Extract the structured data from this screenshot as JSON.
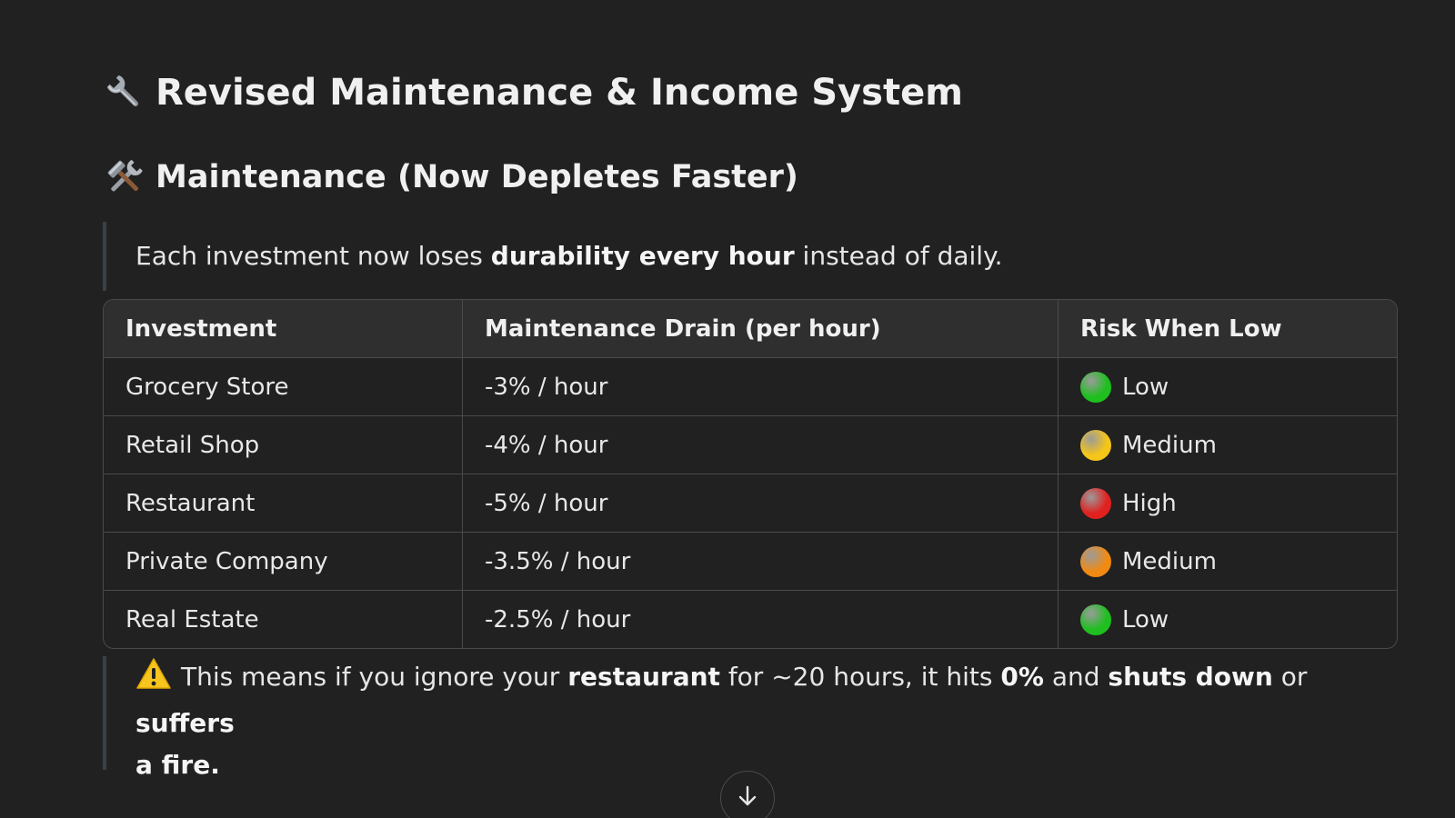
{
  "header": {
    "title": "Revised Maintenance & Income System",
    "title_icon": "wrench-icon",
    "subtitle": "Maintenance (Now Depletes Faster)",
    "subtitle_icon": "hammer-and-wrench-icon"
  },
  "intro": {
    "pre": "Each investment now loses ",
    "bold": "durability every hour",
    "post": " instead of daily."
  },
  "table": {
    "headers": [
      "Investment",
      "Maintenance Drain (per hour)",
      "Risk When Low"
    ],
    "rows": [
      {
        "investment": "Grocery Store",
        "drain": "-3% / hour",
        "risk": "Low",
        "risk_color": "#1fbf1f"
      },
      {
        "investment": "Retail Shop",
        "drain": "-4% / hour",
        "risk": "Medium",
        "risk_color": "#f5c518"
      },
      {
        "investment": "Restaurant",
        "drain": "-5% / hour",
        "risk": "High",
        "risk_color": "#e0211f"
      },
      {
        "investment": "Private Company",
        "drain": "-3.5% / hour",
        "risk": "Medium",
        "risk_color": "#f08a13"
      },
      {
        "investment": "Real Estate",
        "drain": "-2.5% / hour",
        "risk": "Low",
        "risk_color": "#1fbf1f"
      }
    ]
  },
  "warning": {
    "icon": "warning-icon",
    "t1": "This means if you ignore your ",
    "b1": "restaurant",
    "t2": " for ~20 hours, it hits ",
    "b2": "0%",
    "t3": " and ",
    "b3": "shuts down",
    "t4": " or ",
    "b4": "suffers",
    "b5": "a fire."
  },
  "scroll_button": {
    "icon": "arrow-down-icon"
  }
}
